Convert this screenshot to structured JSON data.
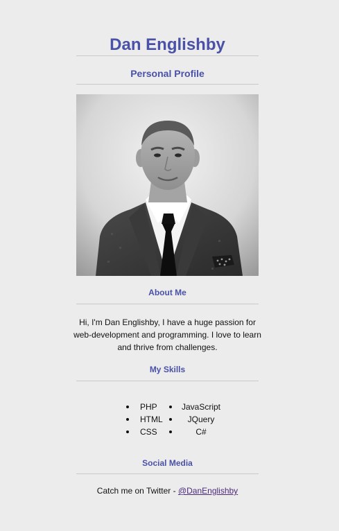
{
  "header": {
    "name": "Dan Englishby",
    "subtitle": "Personal Profile"
  },
  "photo": {
    "alt": "Black and white portrait of Dan Englishby in a suit and tie"
  },
  "about": {
    "title": "About Me",
    "text": "Hi, I'm Dan Englishby, I have a huge passion for web-development and programming. I love to learn and thrive from challenges."
  },
  "skills": {
    "title": "My Skills",
    "column1": [
      "PHP",
      "HTML",
      "CSS"
    ],
    "column2": [
      "JavaScript",
      "JQuery",
      "C#"
    ]
  },
  "social": {
    "title": "Social Media",
    "prefix": "Catch me on Twitter - ",
    "twitter_handle": "@DanEnglishby"
  },
  "colors": {
    "accent": "#4a51a6",
    "background": "#ececec",
    "link_visited": "#4b2a7a"
  }
}
